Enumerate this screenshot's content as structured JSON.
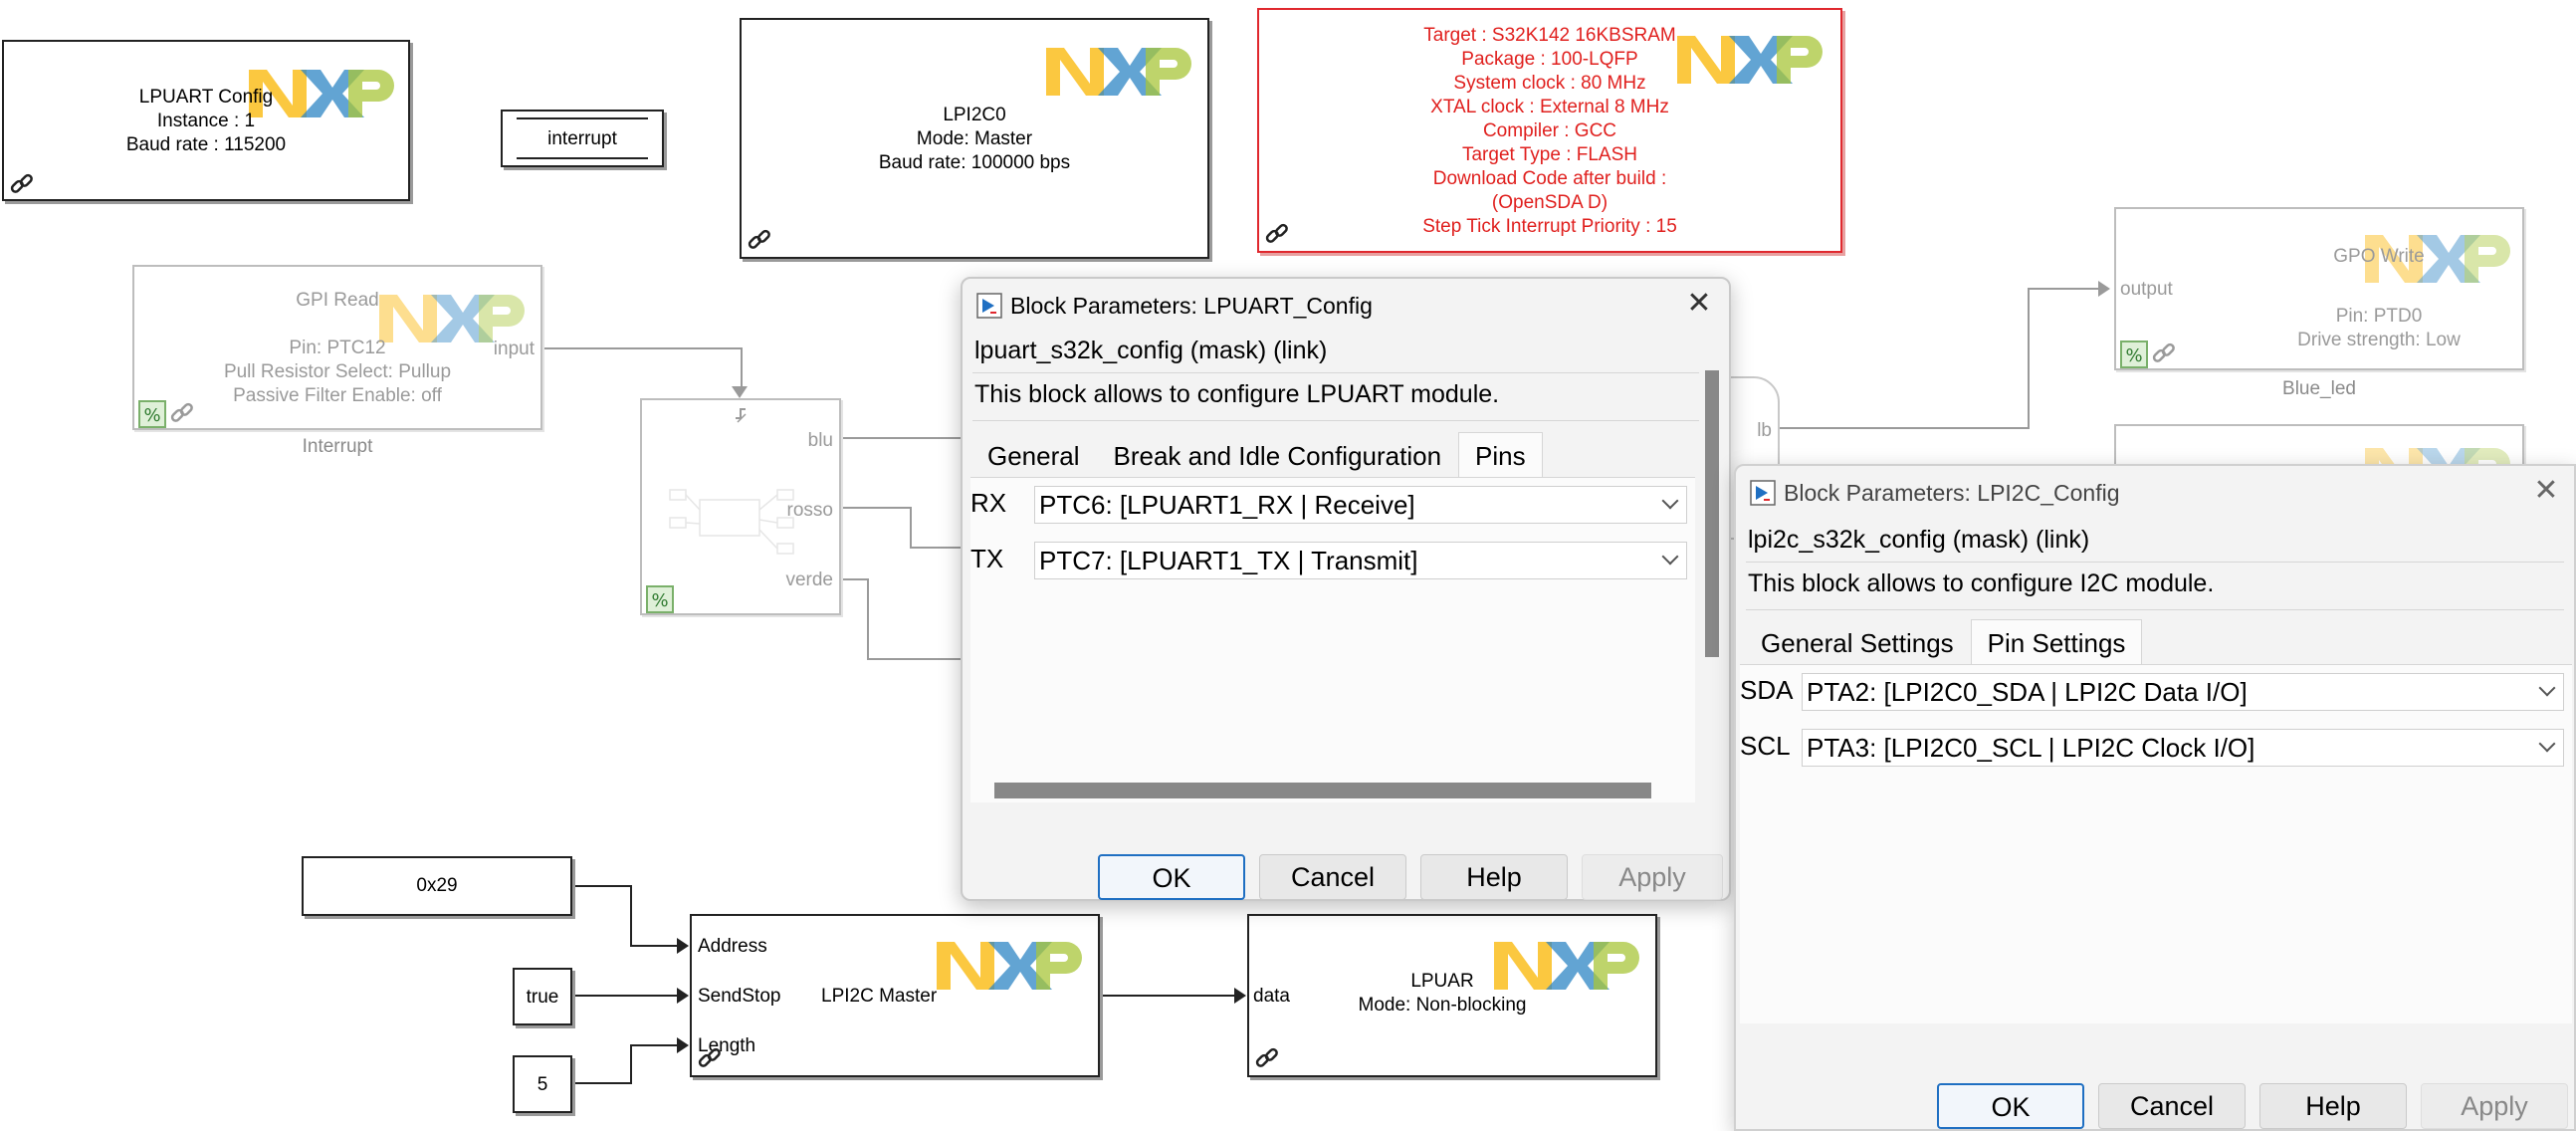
{
  "blocks": {
    "lpuart_config": {
      "lines": [
        "LPUART Config",
        "Instance : 1",
        "Baud rate : 115200"
      ]
    },
    "interrupt_block": {
      "label": "interrupt"
    },
    "lpi2c0": {
      "lines": [
        "LPI2C0",
        "Mode: Master",
        "Baud rate: 100000 bps"
      ]
    },
    "target": {
      "lines": [
        "Target : S32K142 16KBSRAM",
        "Package : 100-LQFP",
        "System clock : 80 MHz",
        "XTAL clock : External 8 MHz",
        "Compiler : GCC",
        "Target Type : FLASH",
        "Download Code after build :",
        "(OpenSDA D)",
        "Step Tick Interrupt Priority : 15"
      ]
    },
    "gpi_read": {
      "title": "GPI Read",
      "lines": [
        "Pin: PTC12",
        "Pull Resistor Select: Pullup",
        "Passive Filter Enable: off"
      ],
      "port_out": "input",
      "caption": "Interrupt"
    },
    "subsystem": {
      "ports": [
        "blu",
        "rosso",
        "verde"
      ]
    },
    "gpo_write": {
      "title": "GPO Write",
      "port_in": "output",
      "lines": [
        "Pin: PTD0",
        "Drive strength: Low"
      ],
      "caption": "Blue_led"
    },
    "rounded_port": "lb",
    "const_addr": "0x29",
    "const_true": "true",
    "const_len": "5",
    "lpi2c_master": {
      "ports": [
        "Address",
        "SendStop",
        "Length"
      ],
      "title": "LPI2C Master"
    },
    "lpuart_tx": {
      "port_in": "data",
      "lines": [
        "LPUAR",
        "Mode: Non-blocking"
      ]
    }
  },
  "dialog_lpuart": {
    "title": "Block Parameters: LPUART_Config",
    "mask": "lpuart_s32k_config (mask) (link)",
    "description": "This block allows to configure LPUART module.",
    "tabs": [
      "General",
      "Break and Idle Configuration",
      "Pins"
    ],
    "active_tab": "Pins",
    "params": [
      {
        "label": "RX",
        "value": "PTC6: [LPUART1_RX | Receive]"
      },
      {
        "label": "TX",
        "value": "PTC7: [LPUART1_TX | Transmit]"
      }
    ],
    "buttons": [
      "OK",
      "Cancel",
      "Help",
      "Apply"
    ]
  },
  "dialog_lpi2c": {
    "title": "Block Parameters: LPI2C_Config",
    "mask": "lpi2c_s32k_config (mask) (link)",
    "description": "This block allows to configure I2C module.",
    "tabs": [
      "General Settings",
      "Pin Settings"
    ],
    "active_tab": "Pin Settings",
    "params": [
      {
        "label": "SDA",
        "value": "PTA2: [LPI2C0_SDA | LPI2C Data I/O]"
      },
      {
        "label": "SCL",
        "value": "PTA3: [LPI2C0_SCL | LPI2C Clock I/O]"
      }
    ],
    "buttons": [
      "OK",
      "Cancel",
      "Help",
      "Apply"
    ]
  },
  "colors": {
    "nxp_orange": "#f9b500",
    "nxp_blue": "#2d85c4",
    "nxp_green": "#a8c63a",
    "target_red": "#e0201e",
    "ok_border": "#1f6fc2"
  },
  "icons": [
    "nxp-logo",
    "link-icon",
    "percent-icon",
    "app-icon",
    "close-icon",
    "chevron-down-icon",
    "trigger-icon"
  ]
}
